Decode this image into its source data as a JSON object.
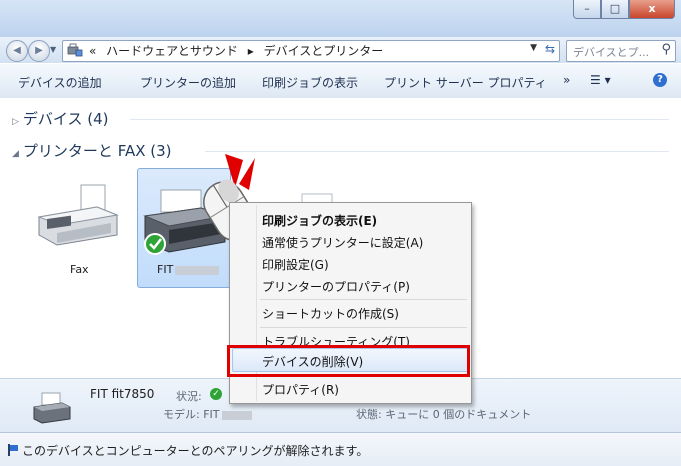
{
  "window": {
    "buttons": {
      "minimize": "–",
      "maximize": "□",
      "close": "x"
    }
  },
  "address_bar": {
    "crumbs": [
      "«",
      "ハードウェアとサウンド",
      "▸",
      "デバイスとプリンター"
    ],
    "search_placeholder": "デバイスとプ..."
  },
  "command_bar": {
    "items": [
      "デバイスの追加",
      "プリンターの追加",
      "印刷ジョブの表示",
      "プリント サーバー プロパティ"
    ],
    "more": "»"
  },
  "groups": [
    {
      "label": "デバイス (4)",
      "expanded": false
    },
    {
      "label": "プリンターと FAX (3)",
      "expanded": true
    }
  ],
  "devices": [
    {
      "label": "Fax",
      "icon": "fax-printer-icon"
    },
    {
      "label": "FIT",
      "icon": "printer-icon",
      "selected": true,
      "default": true
    }
  ],
  "context_menu": {
    "items": [
      "印刷ジョブの表示(E)",
      "通常使うプリンターに設定(A)",
      "印刷設定(G)",
      "プリンターのプロパティ(P)",
      "ショートカットの作成(S)",
      "トラブルシューティング(T)",
      "デバイスの削除(V)",
      "プロパティ(R)"
    ],
    "highlighted": "デバイスの削除(V)"
  },
  "details": {
    "name": "FIT fit7850",
    "status_label": "状況:",
    "model_label": "モデル: FIT",
    "queue_status": "状態: キューに 0 個のドキュメント"
  },
  "statusbar": {
    "text": "このデバイスとコンピューターとのペアリングが解除されます。"
  },
  "colors": {
    "highlight_border": "#e00000",
    "selection": "#cfe3fc",
    "window_frame": "#c3d7f0"
  }
}
